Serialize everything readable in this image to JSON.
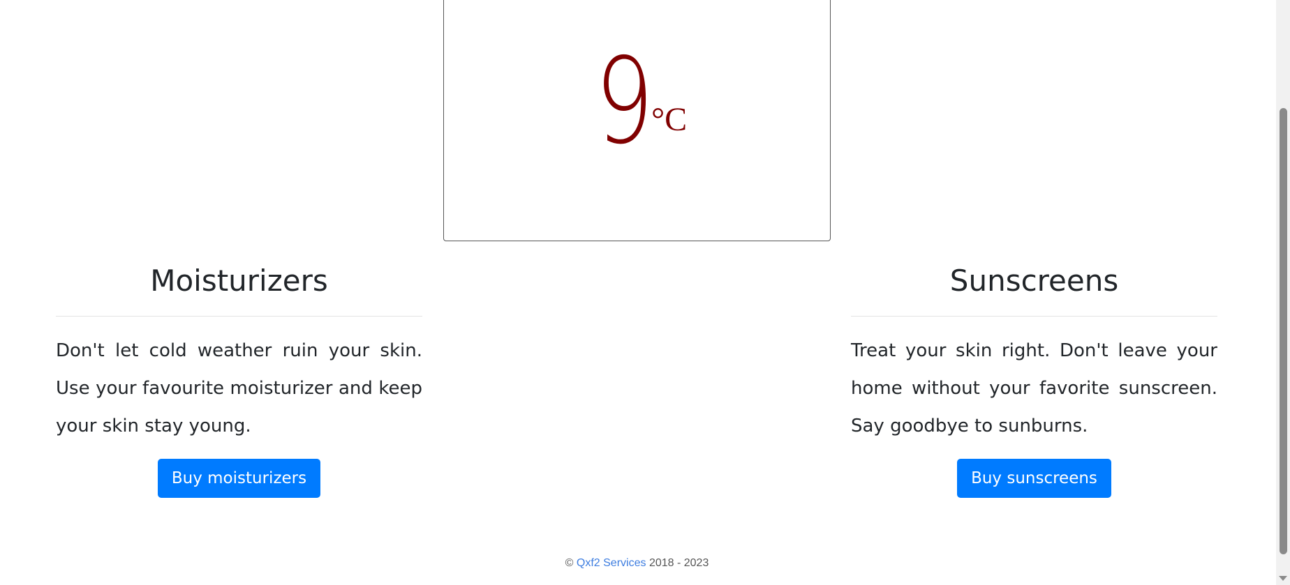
{
  "temperature": {
    "value": "9",
    "unit": "°C",
    "color": "#800000"
  },
  "moisturizers": {
    "title": "Moisturizers",
    "description": "Don't let cold weather ruin your skin. Use your favourite moisturizer and keep your skin stay young.",
    "button_label": "Buy moisturizers"
  },
  "sunscreens": {
    "title": "Sunscreens",
    "description": "Treat your skin right. Don't leave your home without your favorite sunscreen. Say goodbye to sunburns.",
    "button_label": "Buy sunscreens"
  },
  "footer": {
    "copyright_symbol": "©",
    "company_link": "Qxf2 Services",
    "years": "2018 - 2023"
  },
  "colors": {
    "button": "#007bff",
    "link": "#3d7de0"
  }
}
